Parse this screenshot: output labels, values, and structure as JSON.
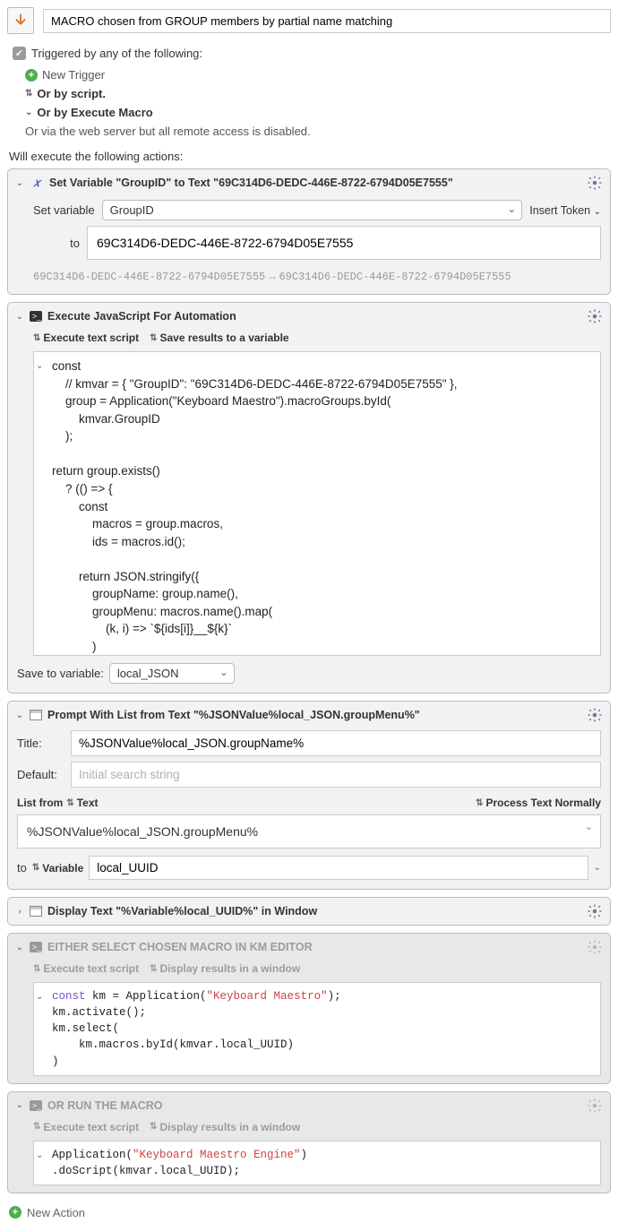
{
  "macro_name": "MACRO chosen from GROUP members by partial name matching",
  "trigger_head": "Triggered by any of the following:",
  "new_trigger": "New Trigger",
  "or_by_script": "Or by script.",
  "or_by_execute": "Or by Execute Macro",
  "webserver_note": "Or via the web server but all remote access is disabled.",
  "actions_label": "Will execute the following actions:",
  "action1": {
    "title": "Set Variable \"GroupID\" to Text \"69C314D6-DEDC-446E-8722-6794D05E7555\"",
    "set_variable_label": "Set variable",
    "variable_name": "GroupID",
    "insert_token": "Insert Token",
    "to_label": "to",
    "value": "69C314D6-DEDC-446E-8722-6794D05E7555",
    "footer_before": "69C314D6-DEDC-446E-8722-6794D05E7555",
    "footer_after": "69C314D6-DEDC-446E-8722-6794D05E7555"
  },
  "action2": {
    "title": "Execute JavaScript For Automation",
    "opt1": "Execute text script",
    "opt2": "Save results to a variable",
    "code": "const\n    // kmvar = { \"GroupID\": \"69C314D6-DEDC-446E-8722-6794D05E7555\" },\n    group = Application(\"Keyboard Maestro\").macroGroups.byId(\n        kmvar.GroupID\n    );\n\nreturn group.exists()\n    ? (() => {\n        const\n            macros = group.macros,\n            ids = macros.id();\n\n        return JSON.stringify({\n            groupName: group.name(),\n            groupMenu: macros.name().map(\n                (k, i) => `${ids[i]}__${k}`\n            )\n                .join(\"\\n\")\n        });\n    })()\n    : `No Group found by UUID: '${kmvar.GroupID}'`;",
    "save_to_label": "Save to variable:",
    "save_to_var": "local_JSON"
  },
  "action3": {
    "title": "Prompt With List from Text \"%JSONValue%local_JSON.groupMenu%\"",
    "title_label": "Title:",
    "title_value": "%JSONValue%local_JSON.groupName%",
    "default_label": "Default:",
    "default_placeholder": "Initial search string",
    "list_from_label": "List from",
    "list_from_mode": "Text",
    "process_mode": "Process Text Normally",
    "list_value": "%JSONValue%local_JSON.groupMenu%",
    "to_label": "to",
    "to_mode": "Variable",
    "to_var": "local_UUID"
  },
  "action4": {
    "title": "Display Text \"%Variable%local_UUID%\" in Window"
  },
  "action5": {
    "title": "EITHER SELECT CHOSEN MACRO IN KM EDITOR",
    "opt1": "Execute text script",
    "opt2": "Display results in a window",
    "code_plain_a": " km = Application(",
    "code_str": "\"Keyboard Maestro\"",
    "code_plain_b": ");\nkm.activate();\nkm.select(\n    km.macros.byId(kmvar.local_UUID)\n)"
  },
  "action6": {
    "title": "OR RUN THE MACRO",
    "opt1": "Execute text script",
    "opt2": "Display results in a window",
    "code_plain_a": "Application(",
    "code_str": "\"Keyboard Maestro Engine\"",
    "code_plain_b": ")\n.doScript(kmvar.local_UUID);"
  },
  "new_action": "New Action"
}
